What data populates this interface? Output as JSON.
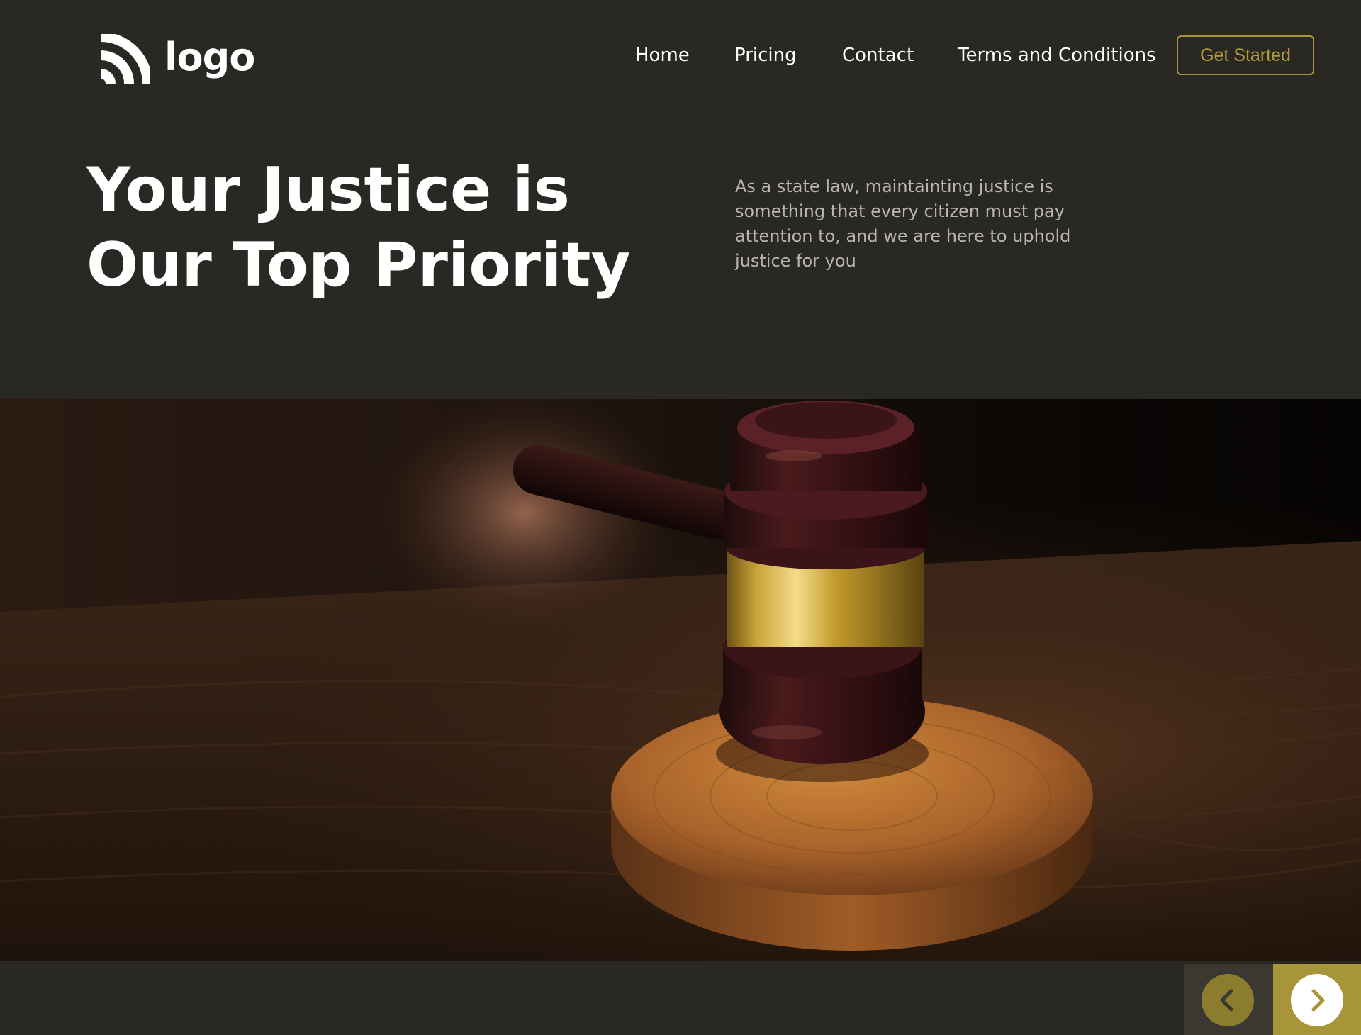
{
  "header": {
    "logo_text": "logo",
    "logo_icon": "signal-arcs-icon",
    "nav": [
      {
        "label": "Home"
      },
      {
        "label": "Pricing"
      },
      {
        "label": "Contact"
      },
      {
        "label": "Terms and Conditions"
      }
    ],
    "cta_label": "Get Started"
  },
  "hero": {
    "title_line1": "Your Justice is",
    "title_line2": "Our Top Priority",
    "description": "As a state law, maintainting justice is something that every citizen must pay attention to, and we are here to uphold justice for you",
    "image_subject": "judge-gavel-photo"
  },
  "slider": {
    "prev_icon": "chevron-left-icon",
    "next_icon": "chevron-right-icon"
  },
  "colors": {
    "background": "#2a2823",
    "accent": "#a8953a",
    "text": "#ffffff",
    "muted_text": "#b8b5ad"
  }
}
